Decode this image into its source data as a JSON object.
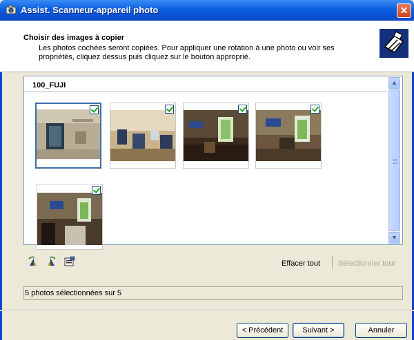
{
  "window": {
    "title": "Assist. Scanneur-appareil photo"
  },
  "header": {
    "heading": "Choisir des images à copier",
    "description": "Les photos cochées seront copiées. Pour appliquer une rotation à une photo ou voir ses propriétés, cliquez dessus puis cliquez sur le bouton approprié."
  },
  "folder": {
    "name": "100_FUJI"
  },
  "photos": [
    {
      "checked": true,
      "selected": true
    },
    {
      "checked": true,
      "selected": false
    },
    {
      "checked": true,
      "selected": false
    },
    {
      "checked": true,
      "selected": false
    },
    {
      "checked": true,
      "selected": false
    }
  ],
  "toolbar": {
    "rotate_left_icon": "rotate-left-icon",
    "rotate_right_icon": "rotate-right-icon",
    "properties_icon": "properties-icon",
    "clear_all": "Effacer tout",
    "select_all": "Sélectionner tout"
  },
  "status": {
    "text": "5 photos sélectionnées sur 5"
  },
  "buttons": {
    "back": "< Précédent",
    "next": "Suivant >",
    "cancel": "Annuler"
  },
  "colors": {
    "titlebar": "#0a5fe0",
    "selection_border": "#3a6ea5",
    "checkmark": "#21a121"
  }
}
